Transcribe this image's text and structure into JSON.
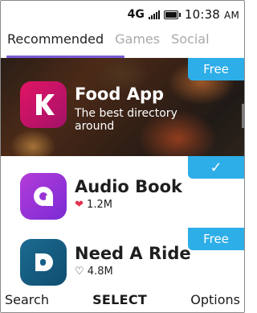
{
  "status_bar": {
    "network": "4G",
    "time": "10:38",
    "ampm": "AM"
  },
  "tabs": [
    {
      "label": "Recommended",
      "active": true
    },
    {
      "label": "Games",
      "active": false
    },
    {
      "label": "Social",
      "active": false
    }
  ],
  "apps": [
    {
      "title": "Food App",
      "subtitle": "The best directory around",
      "badge": "Free",
      "icon": "food-app-k-logo"
    },
    {
      "title": "Audio Book",
      "likes": "1.2M",
      "badge_icon": "check-icon",
      "icon": "audio-book-a-logo"
    },
    {
      "title": "Need A Ride",
      "likes": "4.8M",
      "badge": "Free",
      "icon": "need-a-ride-d-logo"
    }
  ],
  "softkeys": {
    "left": "Search",
    "center": "SELECT",
    "right": "Options"
  },
  "colors": {
    "accent": "#7b5bd6",
    "badge": "#2eaee8",
    "heart": "#e0314b"
  }
}
